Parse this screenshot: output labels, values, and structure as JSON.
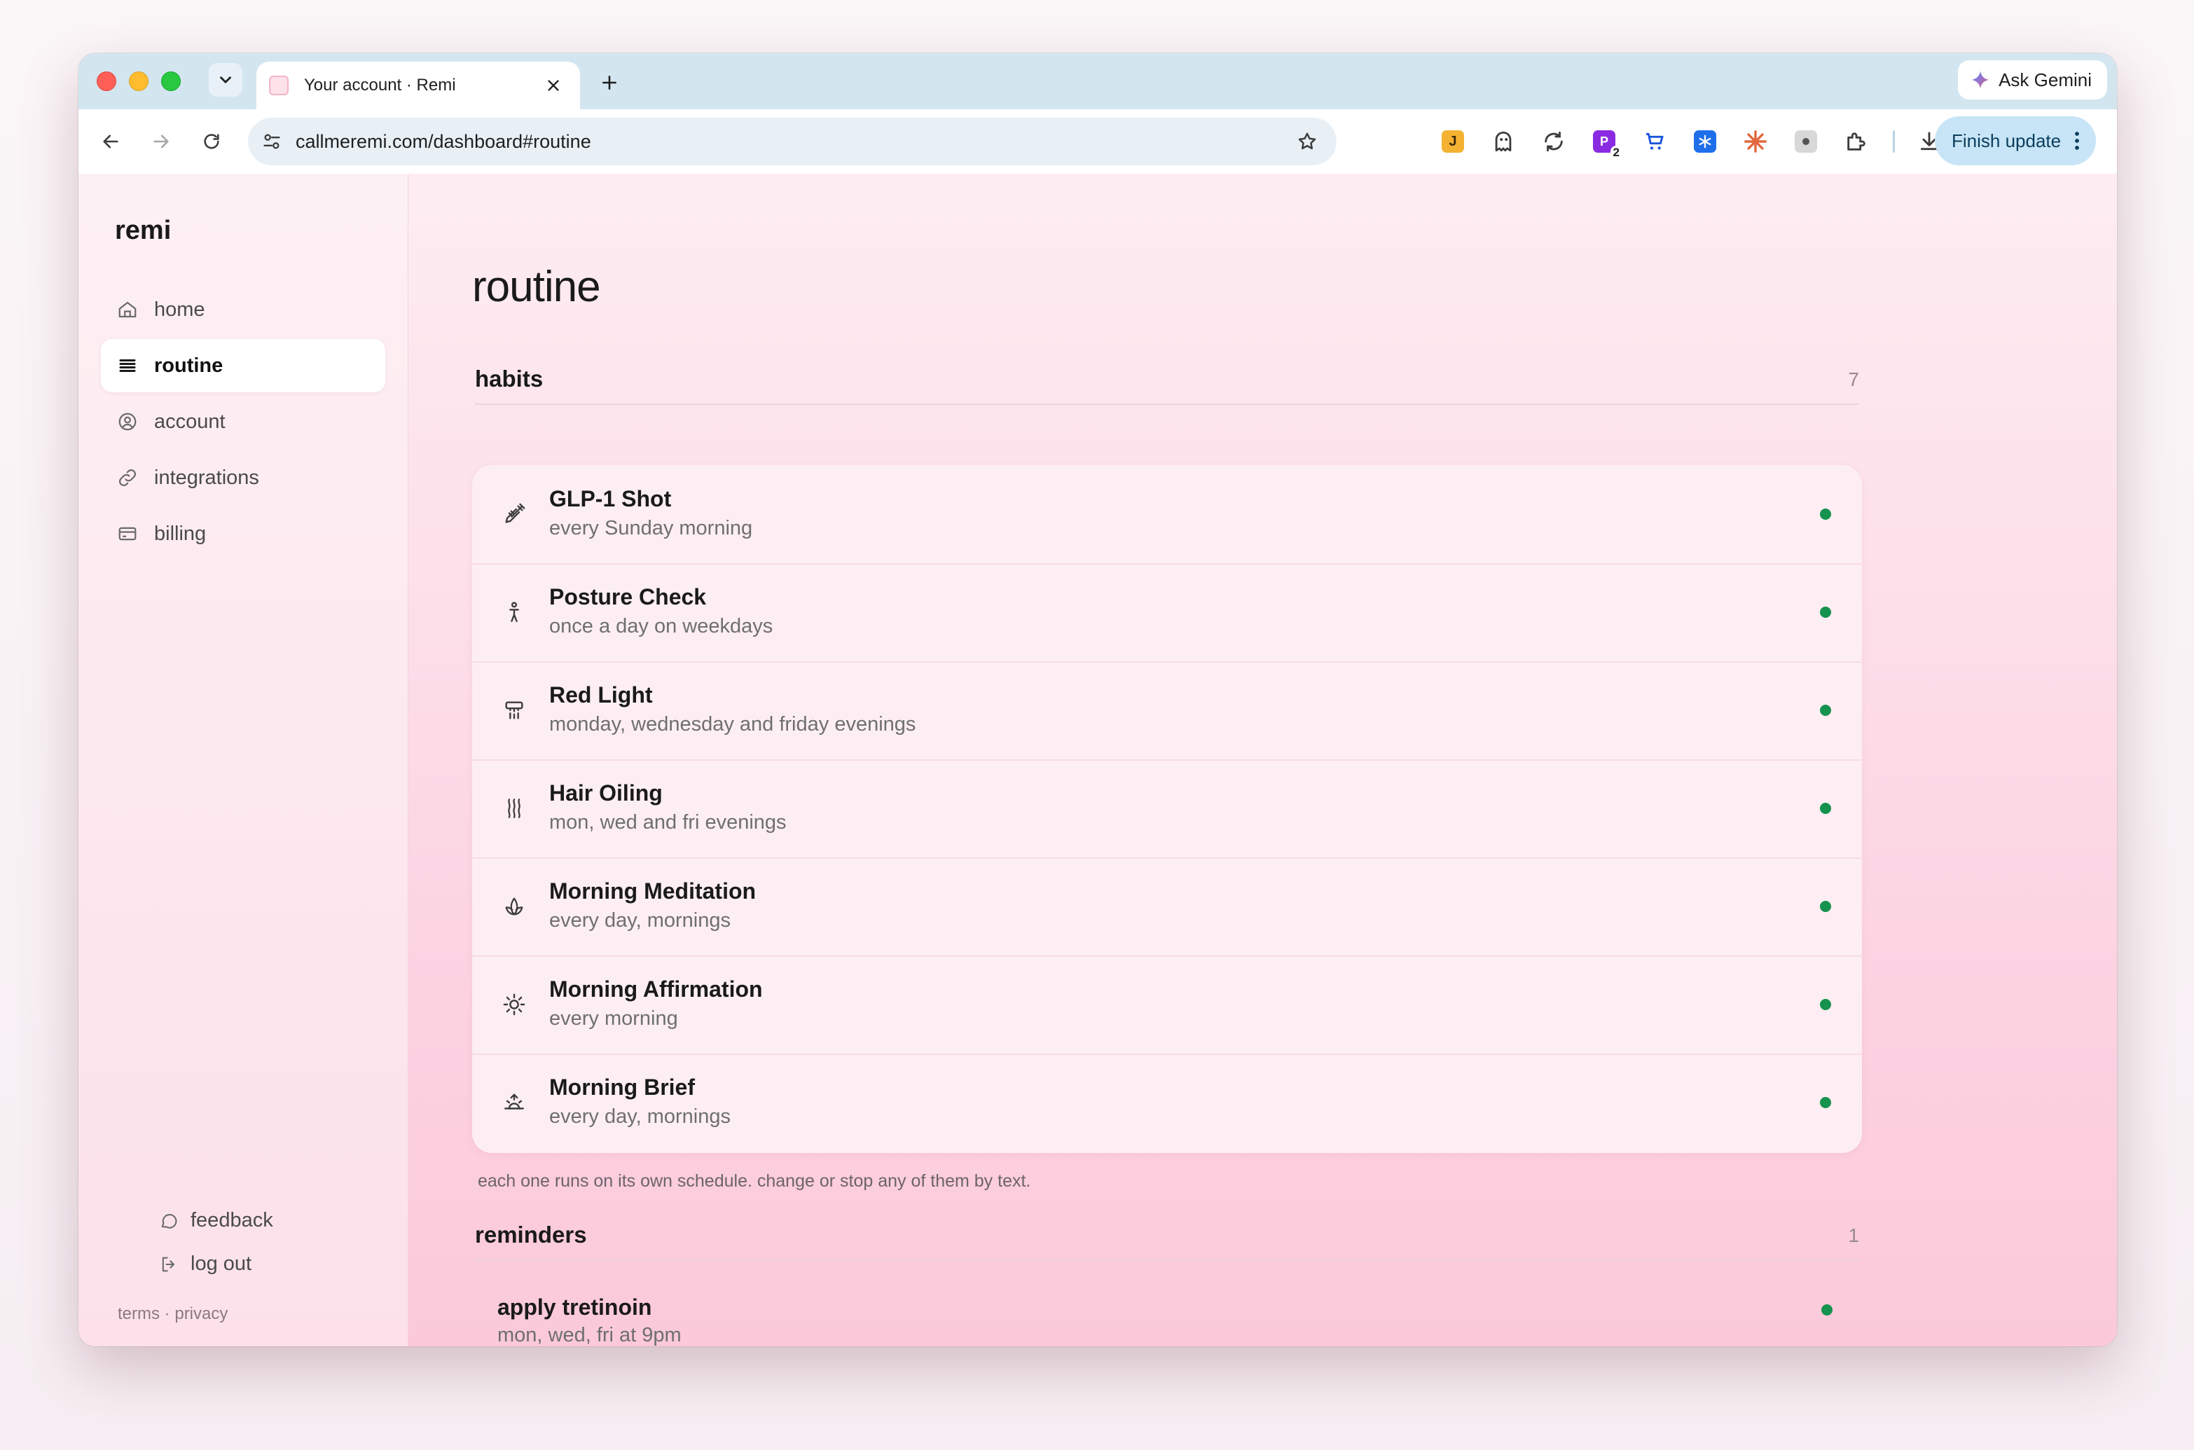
{
  "browser": {
    "tab_title": "Your account · Remi",
    "url": "callmeremi.com/dashboard#routine",
    "ask_gemini_label": "Ask Gemini",
    "finish_update_label": "Finish update",
    "extension_badge": "2"
  },
  "sidebar": {
    "brand": "remi",
    "items": [
      {
        "label": "home",
        "icon": "home-icon"
      },
      {
        "label": "routine",
        "icon": "list-icon",
        "active": true
      },
      {
        "label": "account",
        "icon": "user-circle-icon"
      },
      {
        "label": "integrations",
        "icon": "link-icon"
      },
      {
        "label": "billing",
        "icon": "credit-card-icon"
      }
    ],
    "footer": {
      "feedback": "feedback",
      "logout": "log out",
      "terms": "terms",
      "separator": "·",
      "privacy": "privacy"
    }
  },
  "main": {
    "title": "routine",
    "habits": {
      "title": "habits",
      "count": "7",
      "items": [
        {
          "name": "GLP-1 Shot",
          "schedule": "every Sunday morning",
          "icon": "syringe-icon"
        },
        {
          "name": "Posture Check",
          "schedule": "once a day on weekdays",
          "icon": "person-standing-icon"
        },
        {
          "name": "Red Light",
          "schedule": "monday, wednesday and friday evenings",
          "icon": "lamp-icon"
        },
        {
          "name": "Hair Oiling",
          "schedule": "mon, wed and fri evenings",
          "icon": "droplets-icon"
        },
        {
          "name": "Morning Meditation",
          "schedule": "every day, mornings",
          "icon": "lotus-icon"
        },
        {
          "name": "Morning Affirmation",
          "schedule": "every morning",
          "icon": "sun-icon"
        },
        {
          "name": "Morning Brief",
          "schedule": "every day, mornings",
          "icon": "sunrise-icon"
        }
      ],
      "note": "each one runs on its own schedule. change or stop any of them by text."
    },
    "reminders": {
      "title": "reminders",
      "count": "1",
      "items": [
        {
          "name": "apply tretinoin",
          "schedule": "mon, wed, fri at 9pm"
        }
      ]
    }
  },
  "colors": {
    "accent_status": "#15924d",
    "page_bg": "#fcd2e1",
    "sidebar_bg": "#fdf0f4"
  }
}
